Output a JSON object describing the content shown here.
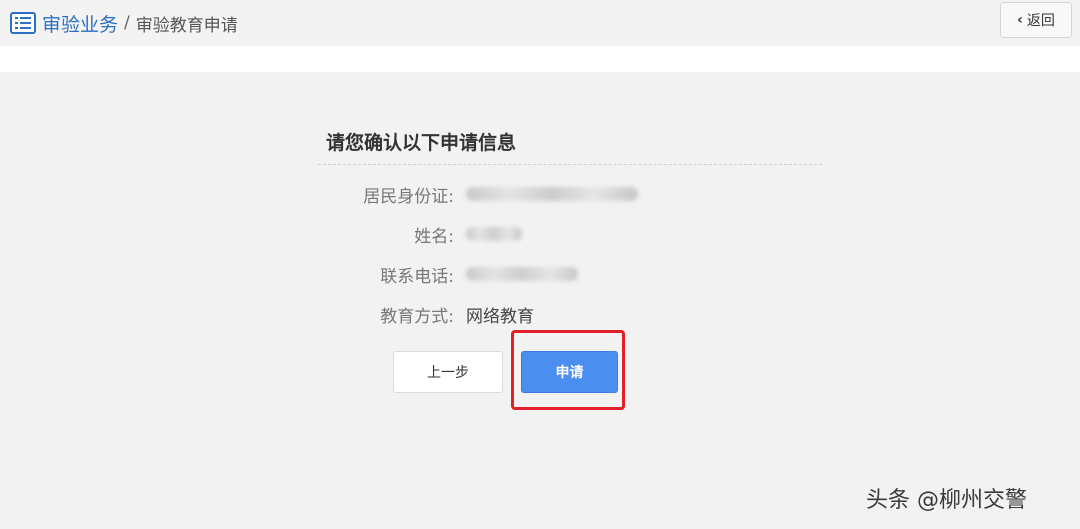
{
  "breadcrumb": {
    "icon": "list-icon",
    "root": "审验业务",
    "separator": "/",
    "current": "审验教育申请"
  },
  "back_button": {
    "icon": "chevron-left-icon",
    "label": "返回"
  },
  "confirm": {
    "title": "请您确认以下申请信息",
    "fields": [
      {
        "label": "居民身份证:",
        "value": ""
      },
      {
        "label": "姓名:",
        "value": ""
      },
      {
        "label": "联系电话:",
        "value": ""
      },
      {
        "label": "教育方式:",
        "value": "网络教育"
      }
    ]
  },
  "buttons": {
    "prev": "上一步",
    "apply": "申请"
  },
  "colors": {
    "accent": "#4a8ef0",
    "highlight": "#e32027",
    "link": "#2b6fc6"
  },
  "watermark": "头条 @柳州交警"
}
